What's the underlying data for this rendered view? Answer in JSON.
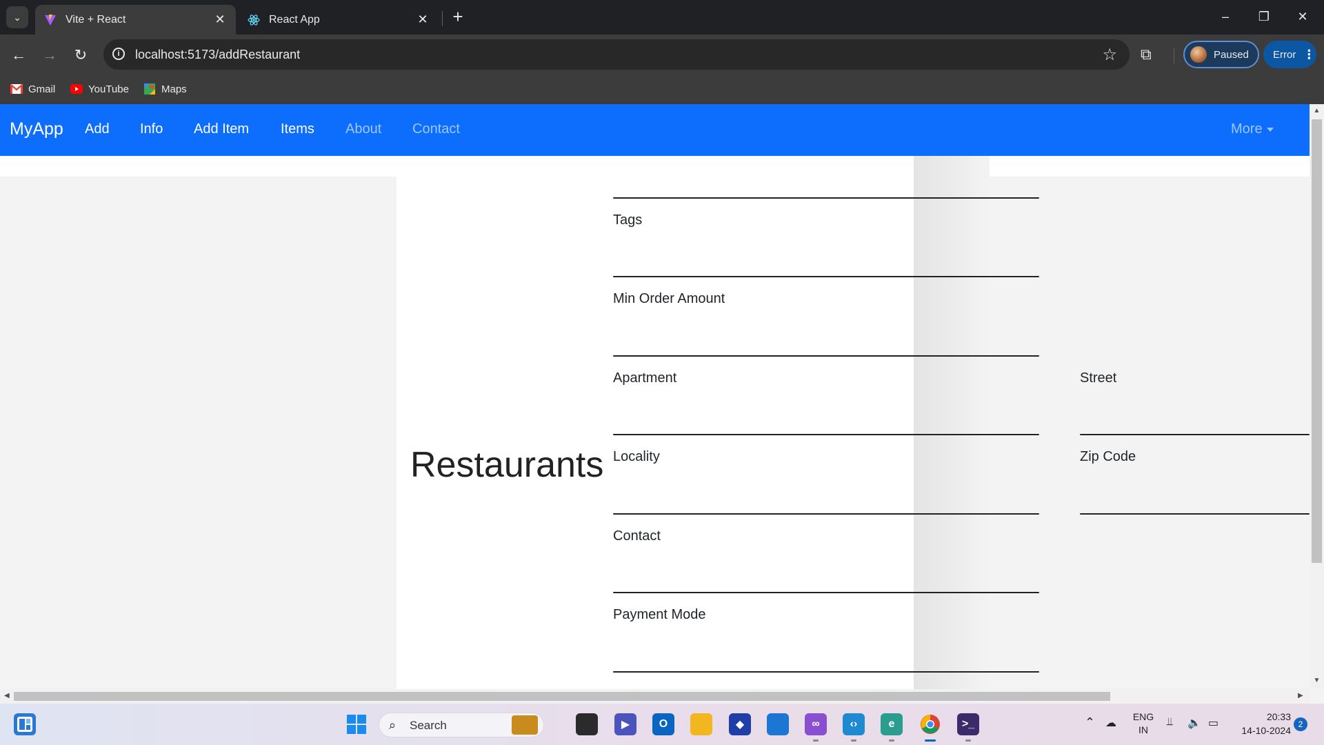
{
  "browser": {
    "tabs": [
      {
        "title": "Vite + React",
        "active": true,
        "icon": "vite-icon"
      },
      {
        "title": "React App",
        "active": false,
        "icon": "react-icon"
      }
    ],
    "address": "localhost:5173/addRestaurant",
    "profile_label": "Paused",
    "error_label": "Error",
    "bookmarks": [
      {
        "label": "Gmail",
        "icon": "gmail-icon"
      },
      {
        "label": "YouTube",
        "icon": "youtube-icon"
      },
      {
        "label": "Maps",
        "icon": "maps-icon"
      }
    ]
  },
  "navbar": {
    "brand": "MyApp",
    "links": [
      "Add",
      "Info",
      "Add Item",
      "Items",
      "About",
      "Contact"
    ],
    "more": "More",
    "color": "#0d6efd"
  },
  "form": {
    "heading": "Restaurants",
    "fields": [
      {
        "label": "Tags",
        "value": ""
      },
      {
        "label": "Min Order Amount",
        "value": ""
      },
      {
        "label": "Apartment",
        "value": ""
      },
      {
        "label": "Street",
        "value": ""
      },
      {
        "label": "Locality",
        "value": ""
      },
      {
        "label": "Zip Code",
        "value": ""
      },
      {
        "label": "Contact",
        "value": ""
      },
      {
        "label": "Payment Mode",
        "value": ""
      }
    ]
  },
  "taskbar": {
    "search_placeholder": "Search",
    "language": "ENG",
    "region": "IN",
    "time": "20:33",
    "date": "14-10-2024",
    "notifications": "2"
  }
}
